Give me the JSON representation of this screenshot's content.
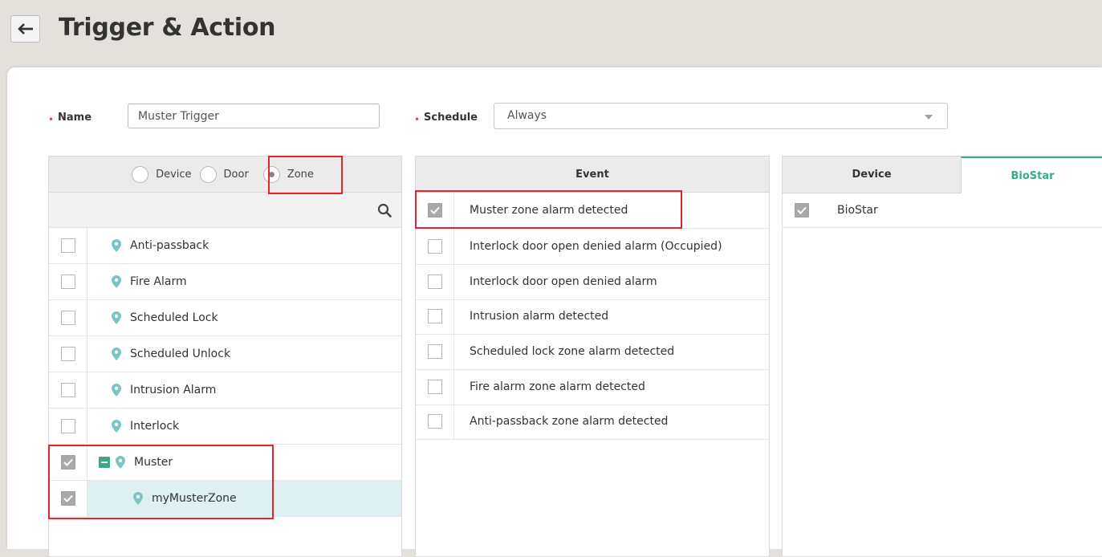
{
  "header": {
    "title": "Trigger & Action"
  },
  "form": {
    "name_label": "Name",
    "name_value": "Muster Trigger",
    "schedule_label": "Schedule",
    "schedule_value": "Always",
    "required_mark": "•"
  },
  "source_panel": {
    "options": [
      {
        "label": "Device",
        "selected": false
      },
      {
        "label": "Door",
        "selected": false
      },
      {
        "label": "Zone",
        "selected": true
      }
    ],
    "items": [
      {
        "label": "Anti-passback",
        "checked": false
      },
      {
        "label": "Fire Alarm",
        "checked": false
      },
      {
        "label": "Scheduled Lock",
        "checked": false
      },
      {
        "label": "Scheduled Unlock",
        "checked": false
      },
      {
        "label": "Intrusion Alarm",
        "checked": false
      },
      {
        "label": "Interlock",
        "checked": false
      },
      {
        "label": "Muster",
        "checked": true
      },
      {
        "label": "myMusterZone",
        "checked": true
      }
    ]
  },
  "event_panel": {
    "header": "Event",
    "items": [
      {
        "label": "Muster zone alarm detected",
        "checked": true
      },
      {
        "label": "Interlock door open denied alarm (Occupied)",
        "checked": false
      },
      {
        "label": "Interlock door open denied alarm",
        "checked": false
      },
      {
        "label": "Intrusion alarm detected",
        "checked": false
      },
      {
        "label": "Scheduled lock zone alarm detected",
        "checked": false
      },
      {
        "label": "Fire alarm zone alarm detected",
        "checked": false
      },
      {
        "label": "Anti-passback zone alarm detected",
        "checked": false
      }
    ]
  },
  "device_panel": {
    "tabs": [
      {
        "label": "Device",
        "active": false
      },
      {
        "label": "BioStar",
        "active": true
      }
    ],
    "items": [
      {
        "label": "BioStar",
        "checked": true
      }
    ]
  },
  "colors": {
    "accent": "#3aa98b",
    "highlight": "#e0262d",
    "selected_row": "#dff0f2",
    "pin": "#7cc4c4"
  },
  "icons": {
    "back": "arrow-left-icon",
    "search": "search-icon",
    "pin": "map-pin-icon",
    "check": "check-icon",
    "dropdown": "chevron-down-icon",
    "collapse": "minus-square-icon"
  }
}
